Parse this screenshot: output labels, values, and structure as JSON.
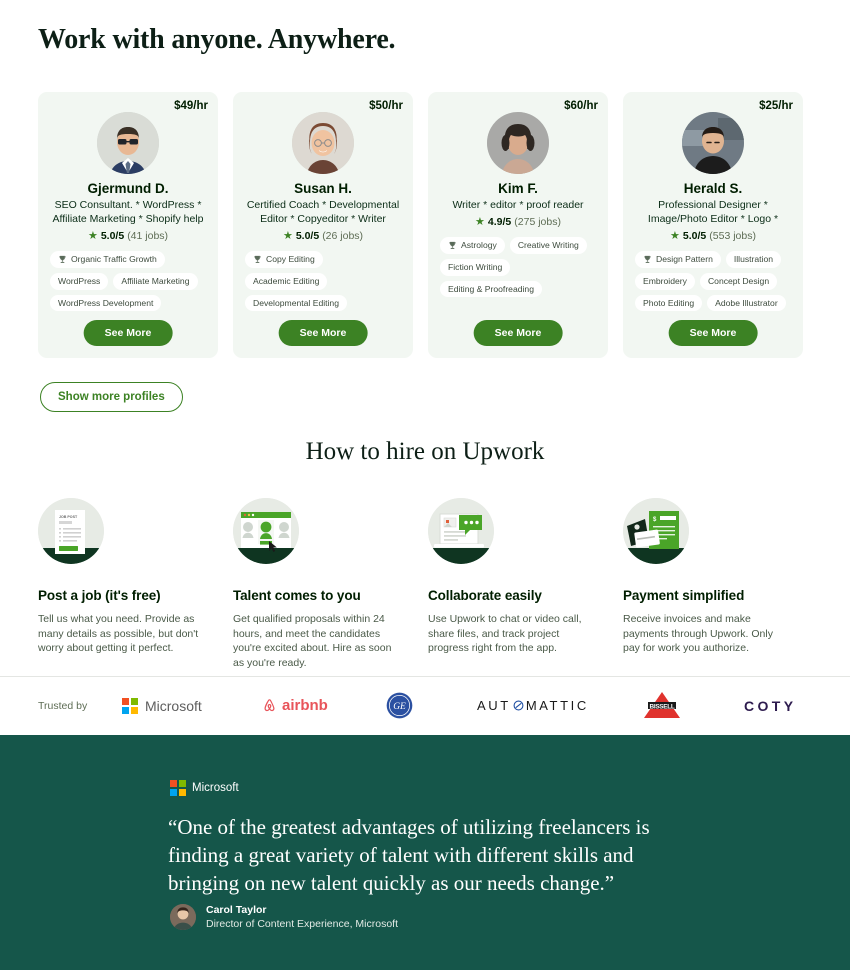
{
  "hero": {
    "title": "Work with anyone. Anywhere."
  },
  "profiles": {
    "show_more_label": "Show more profiles",
    "see_more_label": "See More",
    "star_icon": "star-icon",
    "trophy_icon": "trophy-icon",
    "cards": [
      {
        "name": "Gjermund D.",
        "rate": "$49/hr",
        "title": "SEO Consultant. * WordPress * Affiliate Marketing * Shopify help",
        "score": "5.0/5",
        "jobs": "(41 jobs)",
        "tags": [
          "Organic Traffic Growth",
          "WordPress",
          "Affiliate Marketing",
          "WordPress Development"
        ]
      },
      {
        "name": "Susan H.",
        "rate": "$50/hr",
        "title": "Certified Coach * Developmental Editor * Copyeditor * Writer",
        "score": "5.0/5",
        "jobs": "(26 jobs)",
        "tags": [
          "Copy Editing",
          "Academic Editing",
          "Developmental Editing"
        ]
      },
      {
        "name": "Kim F.",
        "rate": "$60/hr",
        "title": "Writer * editor * proof reader",
        "score": "4.9/5",
        "jobs": "(275 jobs)",
        "tags": [
          "Astrology",
          "Creative Writing",
          "Fiction Writing",
          "Editing & Proofreading"
        ]
      },
      {
        "name": "Herald S.",
        "rate": "$25/hr",
        "title": "Professional Designer * Image/Photo Editor * Logo *",
        "score": "5.0/5",
        "jobs": "(553 jobs)",
        "tags": [
          "Design Pattern",
          "Illustration",
          "Embroidery",
          "Concept Design",
          "Photo Editing",
          "Adobe Illustrator"
        ]
      }
    ]
  },
  "how_to_hire": {
    "heading": "How to hire on Upwork",
    "steps": [
      {
        "icon": "job-post-document-icon",
        "heading": "Post a job (it's free)",
        "body": "Tell us what you need. Provide as many details as possible, but don't worry about getting it perfect."
      },
      {
        "icon": "browser-candidates-icon",
        "heading": "Talent comes to you",
        "body": "Get qualified proposals within 24 hours, and meet the candidates you're excited about. Hire as soon as you're ready."
      },
      {
        "icon": "laptop-chat-bubble-icon",
        "heading": "Collaborate easily",
        "body": "Use Upwork to chat or video call, share files, and track project progress right from the app."
      },
      {
        "icon": "invoice-credit-card-icon",
        "heading": "Payment simplified",
        "body": "Receive invoices and make payments through Upwork. Only pay for work you authorize."
      }
    ]
  },
  "trusted_by": {
    "label": "Trusted by",
    "logos": [
      {
        "name": "microsoft-logo",
        "text": "Microsoft"
      },
      {
        "name": "airbnb-logo",
        "text": "airbnb"
      },
      {
        "name": "ge-logo",
        "text": "GE"
      },
      {
        "name": "automattic-logo",
        "text": "AUT MATTIC"
      },
      {
        "name": "bissell-logo",
        "text": "bissell"
      },
      {
        "name": "coty-logo",
        "text": "COTY"
      }
    ]
  },
  "testimonial": {
    "brand": "Microsoft",
    "quote": "“One of the greatest advantages of utilizing freelancers is finding a great variety of talent with different skills and bringing on new talent quickly as our needs change.”",
    "author_name": "Carol Taylor",
    "author_role": "Director of Content Experience, Microsoft"
  },
  "colors": {
    "brand_green": "#3c8224",
    "dark_green": "#15564a",
    "card_bg": "#f2f7f2",
    "text_dark": "#001e00",
    "airbnb_red": "#e8545a",
    "ge_blue": "#2b50a1",
    "bissell_red": "#e0322d",
    "coty_purple": "#2d1b4e"
  }
}
